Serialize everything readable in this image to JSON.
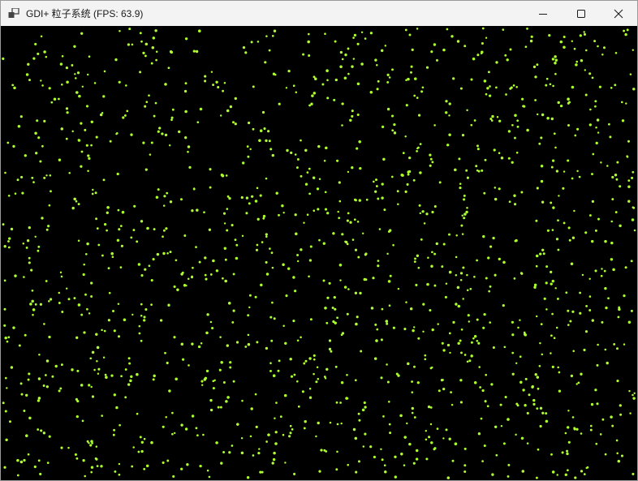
{
  "window": {
    "title": "GDI+ 粒子系统 (FPS: 63.9)",
    "app_icon": "window-app-icon",
    "controls": {
      "minimize_icon": "minimize-icon",
      "maximize_icon": "maximize-icon",
      "close_icon": "close-icon"
    }
  },
  "canvas": {
    "background_color": "#000000",
    "particle_color": "#adff2f",
    "particle_count": 1500
  }
}
